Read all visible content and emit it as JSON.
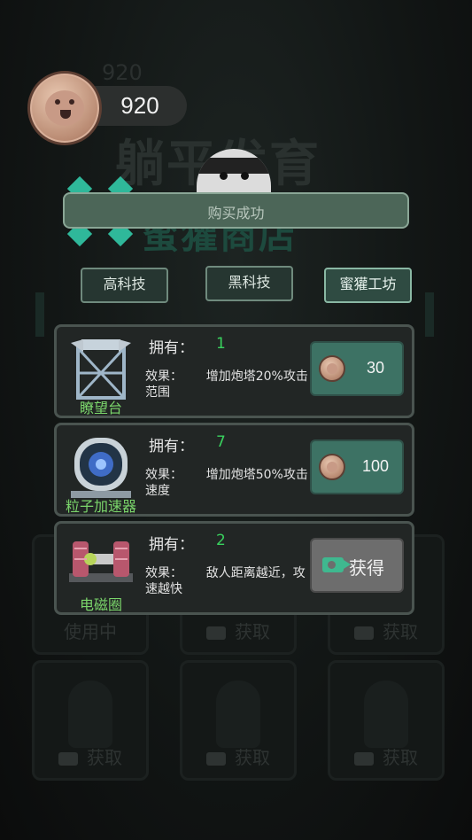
{
  "coins": {
    "amount": "920",
    "ghost_amount": "920"
  },
  "background": {
    "title": "躺平发育",
    "subtitle": "蜜獾商店",
    "cards": [
      {
        "label": "使用中"
      },
      {
        "label": "获取"
      },
      {
        "label": "获取"
      },
      {
        "label": "获取"
      },
      {
        "label": "获取"
      },
      {
        "label": "获取"
      }
    ]
  },
  "header": {
    "text": "购买成功"
  },
  "tabs": [
    {
      "label": "高科技",
      "active": false
    },
    {
      "label": "黑科技",
      "active": false
    },
    {
      "label": "蜜獾工坊",
      "active": true
    }
  ],
  "items": [
    {
      "name": "瞭望台",
      "icon": "watchtower-icon",
      "owned_label": "拥有：",
      "owned": "1",
      "effect_label": "效果：",
      "effect": "增加炮塔20%攻击范围",
      "price": "30",
      "button": "coin-buy"
    },
    {
      "name": "粒子加速器",
      "icon": "particle-accelerator-icon",
      "owned_label": "拥有：",
      "owned": "7",
      "effect_label": "效果：",
      "effect": "增加炮塔50%攻击速度",
      "price": "100",
      "button": "coin-buy"
    },
    {
      "name": "电磁圈",
      "icon": "electromagnetic-coil-icon",
      "owned_label": "拥有：",
      "owned": "2",
      "effect_label": "效果：",
      "effect": "敌人距离越近，攻速越快",
      "get_label": "获得",
      "button": "video-get"
    }
  ],
  "colors": {
    "accent": "#3d7264",
    "owned": "#39d25e",
    "item_label": "#7bd66b",
    "header": "#4c6658"
  }
}
